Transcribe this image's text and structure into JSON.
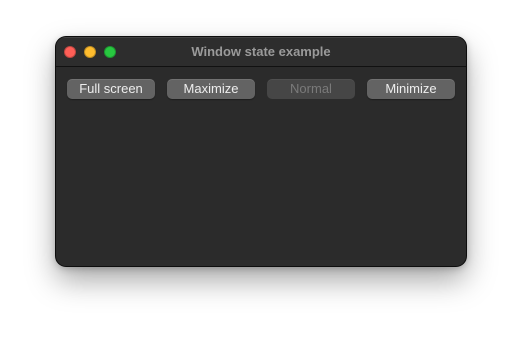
{
  "window": {
    "title": "Window state example"
  },
  "traffic_lights": [
    {
      "name": "close",
      "color": "#fe5f57"
    },
    {
      "name": "minimize",
      "color": "#febc2e"
    },
    {
      "name": "zoom",
      "color": "#28c840"
    }
  ],
  "buttons": [
    {
      "label": "Full screen",
      "enabled": true
    },
    {
      "label": "Maximize",
      "enabled": true
    },
    {
      "label": "Normal",
      "enabled": false
    },
    {
      "label": "Minimize",
      "enabled": true
    }
  ]
}
